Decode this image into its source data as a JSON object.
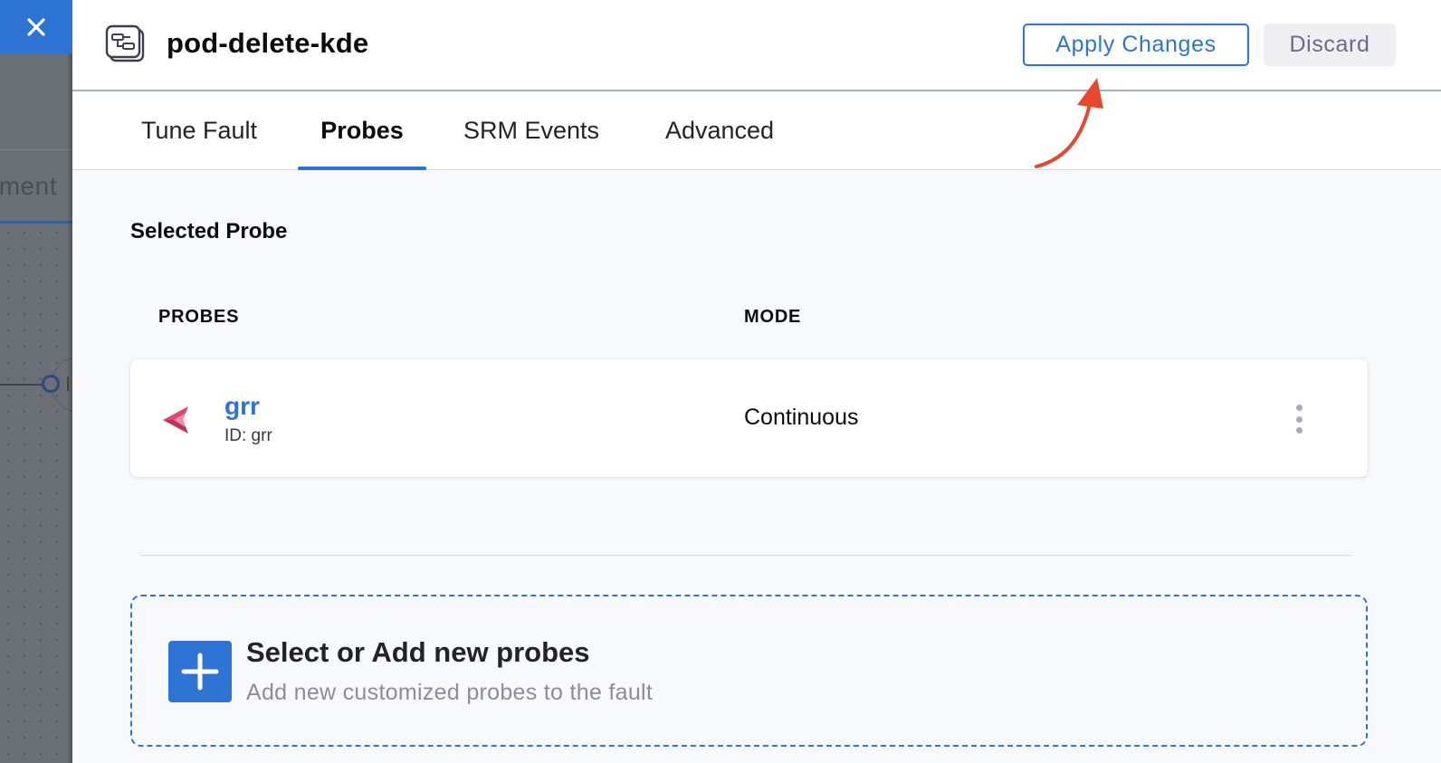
{
  "background": {
    "breadcrumb_fragment": "iment",
    "node_fragment": "I"
  },
  "header": {
    "title": "pod-delete-kde",
    "apply_label": "Apply Changes",
    "discard_label": "Discard"
  },
  "tabs": [
    {
      "label": "Tune Fault",
      "active": false
    },
    {
      "label": "Probes",
      "active": true
    },
    {
      "label": "SRM Events",
      "active": false
    },
    {
      "label": "Advanced",
      "active": false
    }
  ],
  "probes_section": {
    "title": "Selected Probe",
    "columns": [
      "PROBES",
      "MODE"
    ],
    "rows": [
      {
        "name": "grr",
        "id_text": "ID: grr",
        "mode": "Continuous"
      }
    ]
  },
  "add_probe": {
    "title": "Select or Add new probes",
    "subtitle": "Add new customized probes to the fault"
  },
  "colors": {
    "accent": "#2d74d5",
    "probe_icon": "#e2466e",
    "annotation_arrow": "#e8472f",
    "overlay": "#6b6f76"
  },
  "icons": {
    "close": "close-icon",
    "experiment": "experiment-icon",
    "probe": "probe-type-icon",
    "more": "more-options-icon",
    "add": "plus-icon",
    "annotation": "annotation-arrow"
  }
}
